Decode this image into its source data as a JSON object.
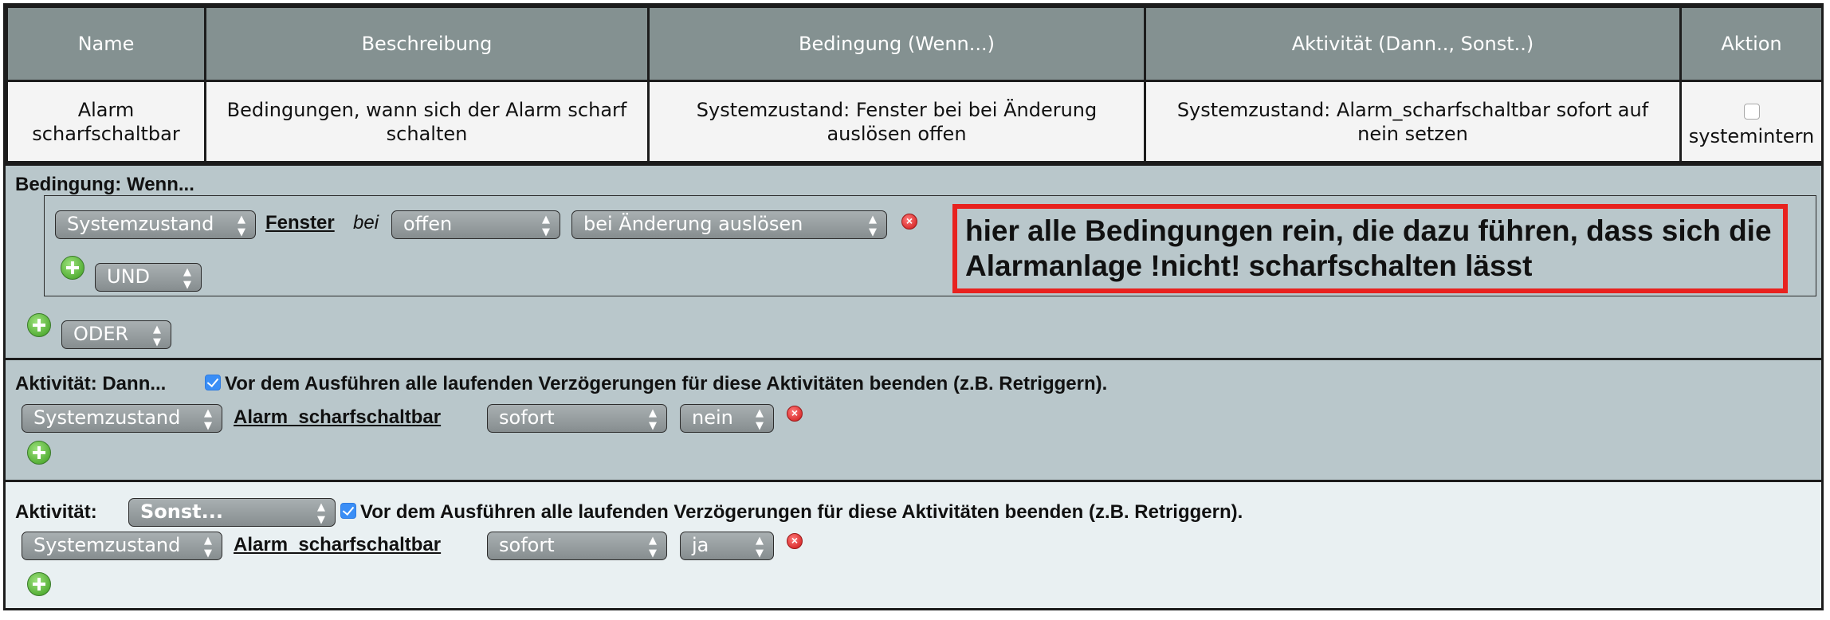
{
  "header": {
    "columns": [
      "Name",
      "Beschreibung",
      "Bedingung (Wenn...)",
      "Aktivität (Dann.., Sonst..)",
      "Aktion"
    ]
  },
  "row": {
    "name": "Alarm scharfschaltbar",
    "description": "Bedingungen, wann sich der Alarm scharf schalten",
    "condition": "Systemzustand: Fenster bei bei Änderung auslösen offen",
    "activity": "Systemzustand: Alarm_scharfschaltbar sofort auf nein setzen",
    "action_label": "systemintern",
    "action_checked": false
  },
  "condition_section": {
    "title": "Bedingung: Wenn...",
    "line": {
      "type_select": "Systemzustand",
      "object_link": "Fenster",
      "bei_text": "bei",
      "value_select": "offen",
      "trigger_select": "bei Änderung auslösen"
    },
    "and_select": "UND",
    "or_select": "ODER",
    "annotation": "hier alle Bedingungen rein, die dazu führen, dass sich die Alarmanlage !nicht! scharfschalten lässt"
  },
  "then_section": {
    "title": "Aktivität: Dann...",
    "checkbox_text": "Vor dem Ausführen alle laufenden Verzögerungen für diese Aktivitäten beenden (z.B. Retriggern).",
    "checked": true,
    "line": {
      "type_select": "Systemzustand",
      "object_link": "Alarm_scharfschaltbar",
      "timing_select": "sofort",
      "value_select": "nein"
    }
  },
  "else_section": {
    "title": "Aktivität:",
    "mode_select": "Sonst...",
    "checkbox_text": "Vor dem Ausführen alle laufenden Verzögerungen für diese Aktivitäten beenden (z.B. Retriggern).",
    "checked": true,
    "line": {
      "type_select": "Systemzustand",
      "object_link": "Alarm_scharfschaltbar",
      "timing_select": "sofort",
      "value_select": "ja"
    }
  },
  "icons": {
    "add": "plus-circle-icon",
    "remove": "close-circle-icon"
  },
  "colors": {
    "header_bg": "#849191",
    "section_bg": "#b9c7cb",
    "annotation_border": "#e8221f",
    "checkbox_accent": "#3a8ef6"
  }
}
